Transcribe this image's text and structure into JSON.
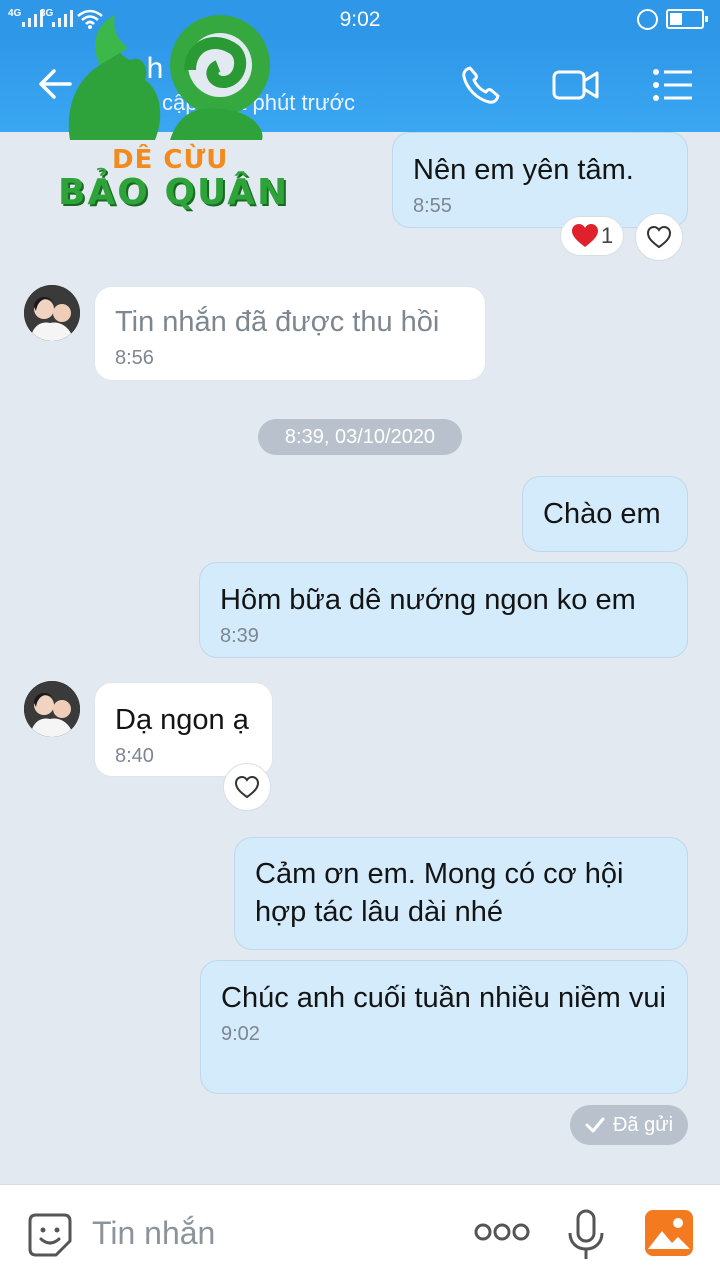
{
  "status_bar": {
    "network_1": "4G",
    "network_2": "3G",
    "time": "9:02"
  },
  "header": {
    "name": "nh",
    "subtitle": "cập nhật phút trước"
  },
  "watermark": {
    "line1": "DÊ CỪU",
    "line2": "BẢO QUÂN"
  },
  "messages": [
    {
      "id": "m1",
      "direction": "out",
      "text": "Nên em yên tâm.",
      "time": "8:55",
      "reaction_count": "1"
    },
    {
      "id": "m2",
      "direction": "in",
      "text": "Tin nhắn đã được thu hồi",
      "time": "8:56",
      "recalled": true
    },
    {
      "id": "m3",
      "direction": "out",
      "text": "Chào em",
      "time": ""
    },
    {
      "id": "m4",
      "direction": "out",
      "text": "Hôm bữa dê nướng ngon ko em",
      "time": "8:39"
    },
    {
      "id": "m5",
      "direction": "in",
      "text": "Dạ ngon ạ",
      "time": "8:40"
    },
    {
      "id": "m6",
      "direction": "out",
      "text": "Cảm ơn em.  Mong có cơ hội hợp tác lâu dài nhé",
      "time": ""
    },
    {
      "id": "m7",
      "direction": "out",
      "text": "Chúc anh cuối tuần nhiều niềm vui",
      "time": "9:02"
    }
  ],
  "date_separator": "8:39, 03/10/2020",
  "sent_status": "Đã gửi",
  "input": {
    "placeholder": "Tin nhắn"
  },
  "icons": {
    "back": "back-arrow-icon",
    "call": "phone-icon",
    "video": "video-camera-icon",
    "menu": "list-menu-icon",
    "emoji": "sticker-icon",
    "more": "more-dots-icon",
    "mic": "microphone-icon",
    "image": "image-icon"
  },
  "colors": {
    "header": "#2f97e8",
    "outgoing_bubble": "#d3ebfb",
    "incoming_bubble": "#ffffff",
    "background": "#e2e9f1",
    "heart": "#e0202a",
    "image_icon": "#f47a1f"
  }
}
